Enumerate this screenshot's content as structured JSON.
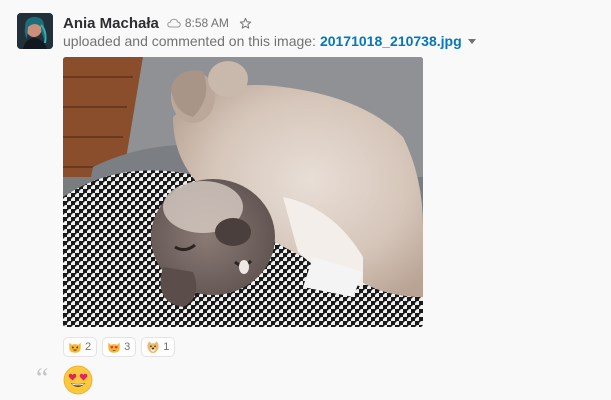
{
  "message": {
    "author": "Ania Machała",
    "timestamp": "8:58 AM",
    "action_text": "uploaded and commented on this image:",
    "file_name": "20171018_210738.jpg",
    "status_icon": "cloud-icon",
    "star_icon": "star-outline-icon",
    "link_color": "#0576b9"
  },
  "reactions": [
    {
      "emoji": "smiley-cat-icon",
      "count": "2"
    },
    {
      "emoji": "heart-eyes-cat-icon",
      "count": "3"
    },
    {
      "emoji": "doge-icon",
      "count": "1"
    }
  ],
  "comment": {
    "emoji": "heart-eyes-icon"
  }
}
